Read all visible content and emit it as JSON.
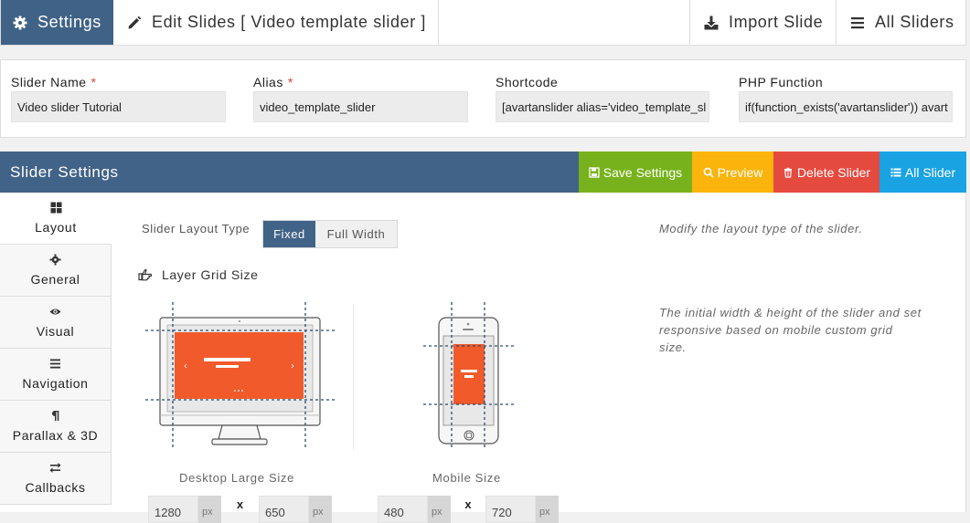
{
  "topnav": {
    "settings": "Settings",
    "edit": "Edit Slides [ Video template slider ]",
    "import": "Import Slide",
    "all_sliders": "All Sliders"
  },
  "info": {
    "name_label": "Slider Name",
    "name_value": "Video slider Tutorial",
    "alias_label": "Alias",
    "alias_value": "video_template_slider",
    "shortcode_label": "Shortcode",
    "shortcode_value": "[avartanslider alias='video_template_sl",
    "php_label": "PHP Function",
    "php_value": "if(function_exists('avartanslider')) avart",
    "required_mark": "*"
  },
  "settings_bar": {
    "title": "Slider Settings",
    "save": "Save Settings",
    "preview": "Preview",
    "delete": "Delete Slider",
    "all": "All Slider"
  },
  "sidetabs": [
    {
      "label": "Layout",
      "icon": "grid-icon"
    },
    {
      "label": "General",
      "icon": "gear-icon"
    },
    {
      "label": "Visual",
      "icon": "eye-icon"
    },
    {
      "label": "Navigation",
      "icon": "menu-icon"
    },
    {
      "label": "Parallax & 3D",
      "icon": "pilcrow-icon"
    },
    {
      "label": "Callbacks",
      "icon": "exchange-icon"
    }
  ],
  "layout": {
    "type_label": "Slider Layout Type",
    "fixed": "Fixed",
    "full_width": "Full Width",
    "type_hint": "Modify the layout type of the slider.",
    "grid_title": "Layer Grid Size",
    "grid_hint_1": "The initial width & height of the slider and set",
    "grid_hint_2": "responsive based on mobile custom grid",
    "grid_hint_3": "size.",
    "desktop_caption": "Desktop Large Size",
    "mobile_caption": "Mobile Size",
    "desktop_w": "1280",
    "desktop_h": "650",
    "mobile_w": "480",
    "mobile_h": "720",
    "unit": "px",
    "times": "x"
  },
  "colors": {
    "primary": "#416388",
    "save": "#77b21d",
    "preview": "#fbb40c",
    "delete": "#e54a3f",
    "all": "#1aa3e2",
    "slide_orange": "#f15a2b"
  }
}
